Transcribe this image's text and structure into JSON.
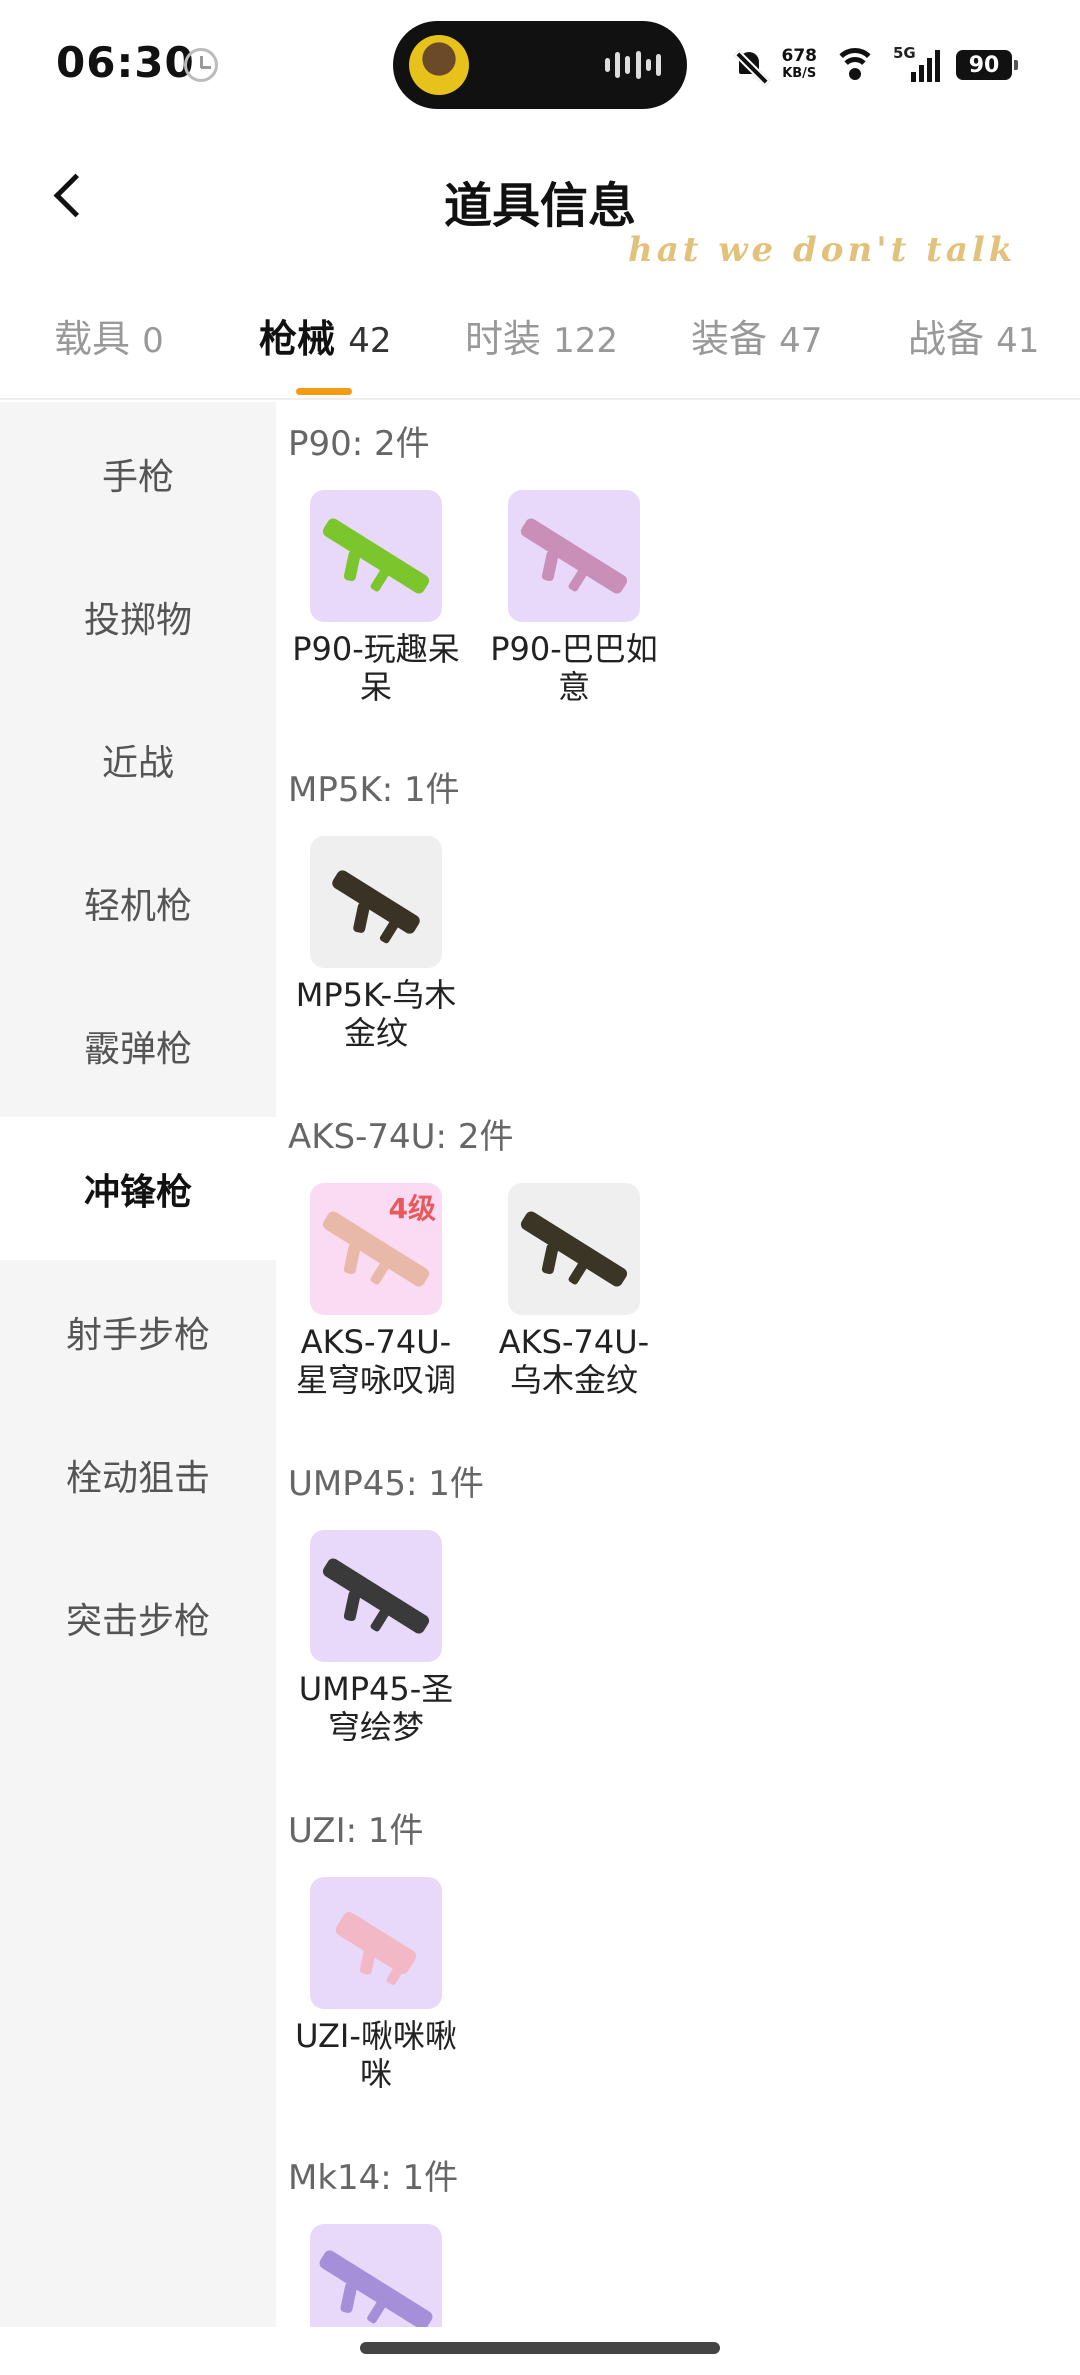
{
  "status_bar": {
    "time": "06:30",
    "net_speed_value": "678",
    "net_speed_unit": "KB/S",
    "network_type": "5G",
    "battery": "90"
  },
  "header": {
    "title": "道具信息",
    "watermark": "hat we don't talk"
  },
  "tabs": [
    {
      "label": "载具",
      "count": "0"
    },
    {
      "label": "枪械",
      "count": "42",
      "active": true
    },
    {
      "label": "时装",
      "count": "122"
    },
    {
      "label": "装备",
      "count": "47"
    },
    {
      "label": "战备",
      "count": "41"
    }
  ],
  "sidebar": {
    "items": [
      {
        "label": "手枪"
      },
      {
        "label": "投掷物"
      },
      {
        "label": "近战"
      },
      {
        "label": "轻机枪"
      },
      {
        "label": "霰弹枪"
      },
      {
        "label": "冲锋枪",
        "active": true
      },
      {
        "label": "射手步枪"
      },
      {
        "label": "栓动狙击"
      },
      {
        "label": "突击步枪"
      }
    ]
  },
  "groups": [
    {
      "title": "P90: 2件",
      "items": [
        {
          "name": "P90-玩趣呆呆",
          "bg": "purple",
          "gun_color": "#7bc62d"
        },
        {
          "name": "P90-巴巴如意",
          "bg": "purple",
          "gun_color": "#c98fb8"
        }
      ]
    },
    {
      "title": "MP5K: 1件",
      "items": [
        {
          "name": "MP5K-乌木金纹",
          "bg": "grey",
          "gun_color": "#3a3325"
        }
      ]
    },
    {
      "title": "AKS-74U: 2件",
      "items": [
        {
          "name": "AKS-74U-星穹咏叹调",
          "bg": "pink",
          "gun_color": "#e8b9a8",
          "level": "4级"
        },
        {
          "name": "AKS-74U-乌木金纹",
          "bg": "grey",
          "gun_color": "#3b3526"
        }
      ]
    },
    {
      "title": "UMP45: 1件",
      "items": [
        {
          "name": "UMP45-圣穹绘梦",
          "bg": "purple",
          "gun_color": "#3a3a3a"
        }
      ]
    },
    {
      "title": "UZI: 1件",
      "items": [
        {
          "name": "UZI-啾咪啾咪",
          "bg": "purple",
          "gun_color": "#f2b8c6"
        }
      ]
    },
    {
      "title": "Mk14: 1件",
      "items": [
        {
          "name": "",
          "bg": "purple",
          "gun_color": "#a48fd8"
        }
      ]
    }
  ]
}
